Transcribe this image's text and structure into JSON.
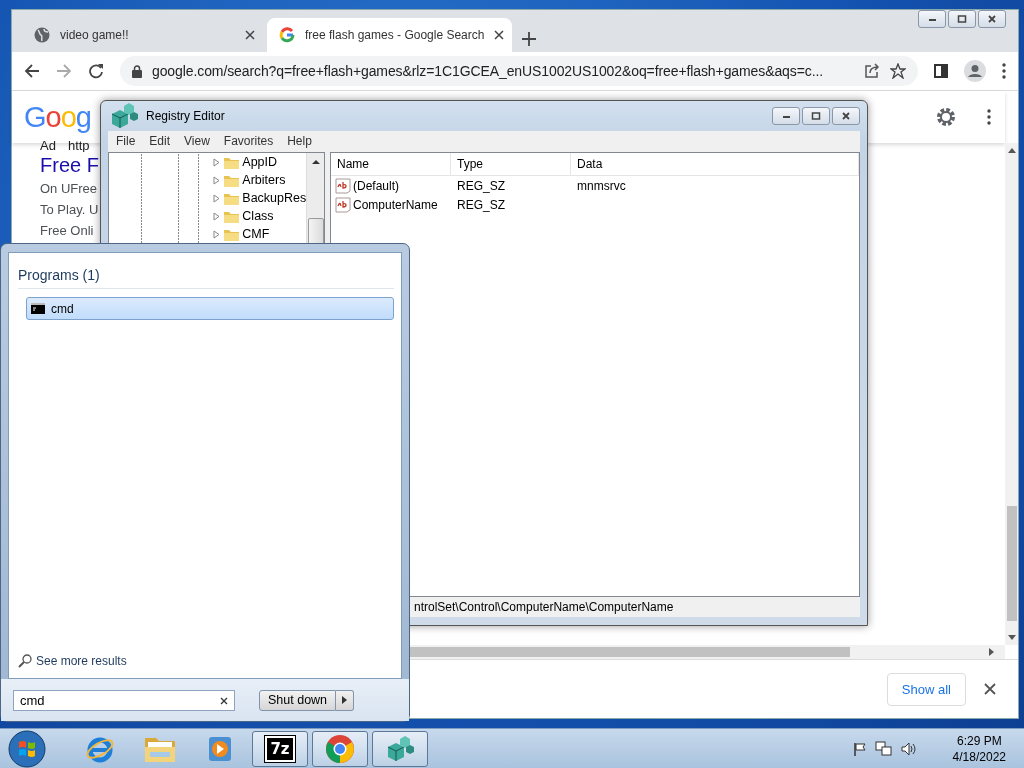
{
  "browser": {
    "tabs": [
      {
        "title": "video game!!",
        "kind": "globe",
        "selected": false
      },
      {
        "title": "free flash games - Google Search",
        "kind": "google",
        "selected": true
      }
    ],
    "address": "google.com/search?q=free+flash+games&rlz=1C1GCEA_enUS1002US1002&oq=free+flash+games&aqs=c...",
    "page": {
      "logo": "Goog",
      "ad_label": "Ad",
      "ad_url": "http",
      "result_title": "Free F",
      "snippet_lines": [
        "On UFree",
        "To Play. U",
        "Free Onli"
      ]
    },
    "downloads_bar": {
      "button": "Show all"
    }
  },
  "registry_editor": {
    "title": "Registry Editor",
    "menu": [
      "File",
      "Edit",
      "View",
      "Favorites",
      "Help"
    ],
    "tree_items": [
      {
        "label": "AppID"
      },
      {
        "label": "Arbiters"
      },
      {
        "label": "BackupRes"
      },
      {
        "label": "Class"
      },
      {
        "label": "CMF"
      }
    ],
    "columns": [
      "Name",
      "Type",
      "Data"
    ],
    "values": [
      {
        "name": "(Default)",
        "type": "REG_SZ",
        "data": "mnmsrvc"
      },
      {
        "name": "ComputerName",
        "type": "REG_SZ"
      }
    ],
    "status": "ntrolSet\\Control\\ComputerName\\ComputerName"
  },
  "start_menu": {
    "group_title": "Programs (1)",
    "results": [
      {
        "label": "cmd",
        "selected": true
      }
    ],
    "see_more": "See more results",
    "search": {
      "value": "cmd"
    },
    "shutdown": "Shut down"
  },
  "taskbar": {
    "apps": [
      {
        "kind": "ie",
        "running": false
      },
      {
        "kind": "explorer",
        "running": false
      },
      {
        "kind": "media",
        "running": false
      },
      {
        "kind": "archiver",
        "label": "7z",
        "running": true
      },
      {
        "kind": "chrome",
        "running": true
      },
      {
        "kind": "regedit",
        "running": true
      }
    ],
    "clock": {
      "time": "6:29 PM",
      "date": "4/18/2022"
    }
  }
}
